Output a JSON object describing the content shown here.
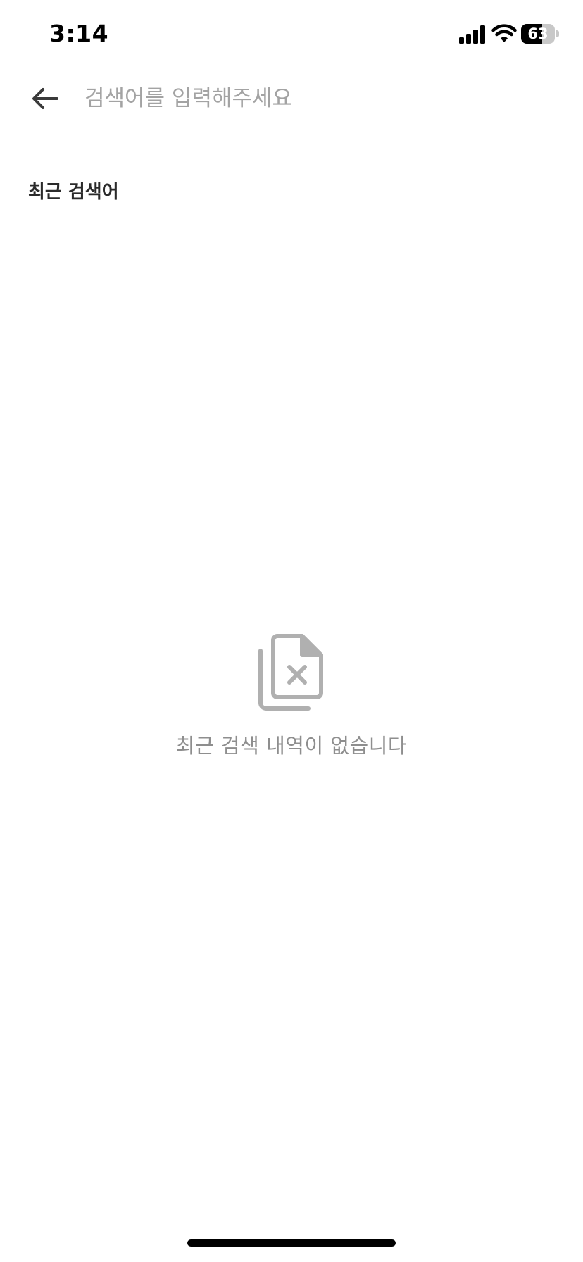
{
  "status_bar": {
    "time": "3:14",
    "battery_level": "63",
    "battery_fraction": 0.63
  },
  "header": {
    "back_icon": "arrow-left-icon",
    "search_placeholder": "검색어를 입력해주세요",
    "search_value": ""
  },
  "recent": {
    "title": "최근 검색어",
    "items": [],
    "empty_icon": "document-x-icon",
    "empty_message": "최근 검색 내역이 없습니다"
  },
  "colors": {
    "placeholder": "#a3a3a3",
    "icon_gray": "#b0b0b0",
    "empty_text": "#8e8e8e",
    "title_text": "#2a2a2a"
  }
}
